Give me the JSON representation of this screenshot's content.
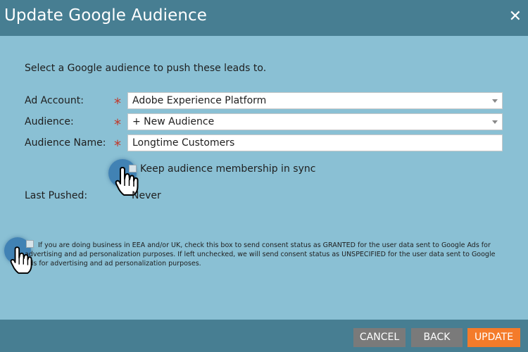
{
  "dialog": {
    "title": "Update Google Audience",
    "close_icon": "close-icon"
  },
  "intro_text": "Select a Google audience to push these leads to.",
  "form": {
    "ad_account": {
      "label": "Ad Account:",
      "value": "Adobe Experience Platform"
    },
    "audience": {
      "label": "Audience:",
      "value": "+ New Audience"
    },
    "audience_name": {
      "label": "Audience Name:",
      "value": "Longtime Customers"
    },
    "required_marker": "*",
    "sync_checkbox_label": "Keep audience membership in sync",
    "last_pushed": {
      "label": "Last Pushed:",
      "value": "Never"
    }
  },
  "consent_text": "If you are doing business in EEA and/or UK, check this box to send consent status as GRANTED for the user data sent to Google Ads for advertising and ad personalization purposes. If left unchecked, we will send consent status as UNSPECIFIED for the user data sent to Google Ads for advertising and ad personalization purposes.",
  "footer": {
    "cancel": "CANCEL",
    "back": "BACK",
    "update": "UPDATE"
  },
  "colors": {
    "titlebar": "#477e92",
    "body": "#8ac0d4",
    "required": "#c0392b",
    "update_button": "#f47b2a",
    "secondary_button": "#7a7a7a"
  }
}
